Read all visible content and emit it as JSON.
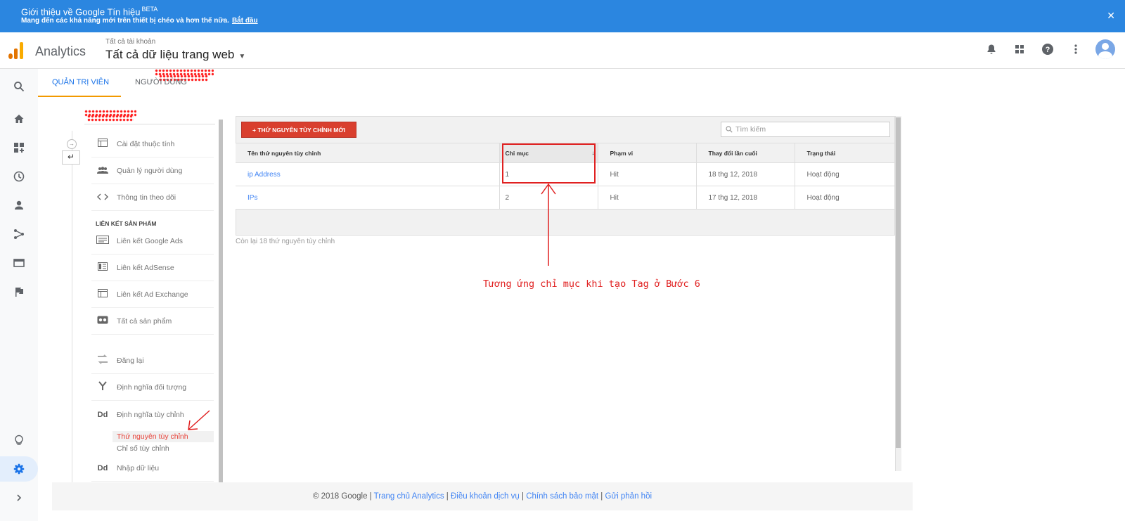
{
  "banner": {
    "title": "Giới thiệu về Google Tín hiệu",
    "badge": "BETA",
    "subtitle": "Mang đến các khả năng mới trên thiết bị chéo và hơn thế nữa.",
    "link": "Bắt đầu",
    "close_icon": "✕"
  },
  "header": {
    "brand": "Analytics",
    "account_small": "Tất cả tài khoản",
    "account_big": "Tất cả dữ liệu trang web",
    "logo_colors": [
      "#f9ab00",
      "#e37400",
      "#e37400"
    ]
  },
  "rail": {
    "icons": [
      "search-icon",
      "home-icon",
      "dashboard-icon",
      "clock-icon",
      "person-icon",
      "acquisition-icon",
      "behavior-icon",
      "flag-icon",
      "lightbulb-icon",
      "gear-icon",
      "expand-icon"
    ]
  },
  "tabs": [
    "QUẢN TRỊ VIÊN",
    "NGƯỜI DÙNG"
  ],
  "nav": {
    "items": [
      {
        "icon": "window-icon",
        "label": "Cài đặt thuộc tính"
      },
      {
        "icon": "people-icon",
        "label": "Quản lý người dùng"
      },
      {
        "icon": "code-icon",
        "label": "Thông tin theo dõi"
      }
    ],
    "section": "LIÊN KẾT SẢN PHẨM",
    "links": [
      {
        "icon": "ads-icon",
        "label": "Liên kết Google Ads"
      },
      {
        "icon": "adsense-icon",
        "label": "Liên kết AdSense"
      },
      {
        "icon": "adexchange-icon",
        "label": "Liên kết Ad Exchange"
      },
      {
        "icon": "products-icon",
        "label": "Tất cả sản phẩm"
      }
    ],
    "more": [
      {
        "icon": "remarketing-icon",
        "label": "Đăng lại"
      },
      {
        "icon": "audience-icon",
        "label": "Định nghĩa đối tượng"
      },
      {
        "icon": "dd-icon",
        "label": "Định nghĩa tùy chỉnh"
      }
    ],
    "sub": [
      "Thứ nguyên tùy chỉnh",
      "Chỉ số tùy chỉnh"
    ],
    "import": {
      "icon": "dd-icon",
      "label": "Nhập dữ liệu"
    },
    "dd_glyph": "Dd"
  },
  "table": {
    "add_button": "+ THỨ NGUYÊN TÙY CHỈNH MỚI",
    "search_placeholder": "Tìm kiếm",
    "headers": [
      "Tên thứ nguyên tùy chỉnh",
      "Chỉ mục",
      "Phạm vi",
      "Thay đổi lần cuối",
      "Trạng thái"
    ],
    "rows": [
      [
        "ip Address",
        "1",
        "Hit",
        "18 thg 12, 2018",
        "Hoạt động"
      ],
      [
        "IPs",
        "2",
        "Hit",
        "17 thg 12, 2018",
        "Hoạt động"
      ]
    ],
    "remaining": "Còn lại 18 thứ nguyên tùy chỉnh"
  },
  "annotation": "Tương ứng chỉ mục khi tạo Tag ở Bước 6",
  "footer": {
    "copyright": "© 2018 Google",
    "links": [
      "Trang chủ Analytics",
      "Điều khoản dịch vụ",
      "Chính sách bảo mật",
      "Gửi phản hồi"
    ]
  }
}
